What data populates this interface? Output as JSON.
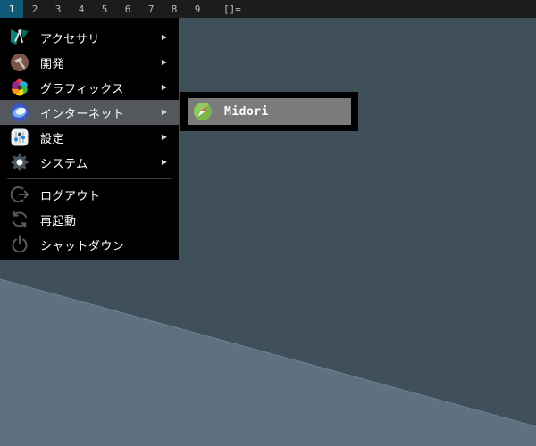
{
  "bar": {
    "tags": [
      "1",
      "2",
      "3",
      "4",
      "5",
      "6",
      "7",
      "8",
      "9"
    ],
    "selected_tag": "1",
    "layout_symbol": "[]=",
    "colors": {
      "bg": "#1a1c1d",
      "selected_bg": "#0f5b77",
      "text": "#b9bbbc",
      "selected_text": "#eef2f3"
    }
  },
  "menu": {
    "submenu_arrow": "▶",
    "categories": [
      {
        "label": "アクセサリ",
        "icon": "accessories-icon",
        "has_submenu": true,
        "highlighted": false
      },
      {
        "label": "開発",
        "icon": "development-icon",
        "has_submenu": true,
        "highlighted": false
      },
      {
        "label": "グラフィックス",
        "icon": "graphics-icon",
        "has_submenu": true,
        "highlighted": false
      },
      {
        "label": "インターネット",
        "icon": "internet-icon",
        "has_submenu": true,
        "highlighted": true
      },
      {
        "label": "設定",
        "icon": "settings-icon",
        "has_submenu": true,
        "highlighted": false
      },
      {
        "label": "システム",
        "icon": "system-icon",
        "has_submenu": true,
        "highlighted": false
      }
    ],
    "session_items": [
      {
        "label": "ログアウト",
        "icon": "logout-icon"
      },
      {
        "label": "再起動",
        "icon": "restart-icon"
      },
      {
        "label": "シャットダウン",
        "icon": "shutdown-icon"
      }
    ],
    "colors": {
      "bg": "#000000",
      "text": "#ffffff",
      "highlight_bg": "#54575b"
    }
  },
  "submenu": {
    "items": [
      {
        "label": "Midori",
        "icon": "midori-icon",
        "highlighted": true
      }
    ],
    "colors": {
      "border": "#000000",
      "item_bg": "#7b7b7b",
      "text": "#ffffff"
    }
  },
  "desktop": {
    "dark_color": "#3f505b",
    "light_color": "#5e7181"
  }
}
